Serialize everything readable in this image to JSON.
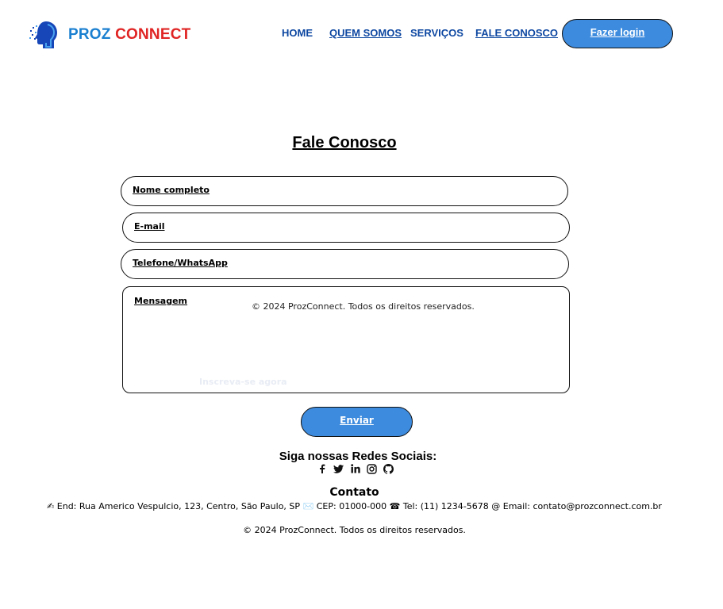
{
  "header": {
    "brand_part1": "PROZ",
    "brand_part2": "CONNECT",
    "nav": [
      {
        "label": "HOME"
      },
      {
        "label": "QUEM SOMOS"
      },
      {
        "label": "SERVIÇOS"
      },
      {
        "label": "FALE CONOSCO"
      }
    ],
    "login_label": "Fazer login"
  },
  "page": {
    "title": "Fale Conosco"
  },
  "form": {
    "name_label": "Nome completo",
    "email_label": "E-mail",
    "phone_label": "Telefone/WhatsApp",
    "message_label": "Mensagem",
    "overlay_copyright": "© 2024 ProzConnect. Todos os direitos reservados.",
    "ghost_link": "Inscreva-se agora",
    "submit_label": "Enviar"
  },
  "footer": {
    "social_title": "Siga nossas Redes Sociais:",
    "social_icons": [
      "facebook-icon",
      "twitter-icon",
      "linkedin-icon",
      "instagram-icon",
      "github-icon"
    ],
    "contact_title": "Contato",
    "address": "✍ End: Rua Americo Vespulcio, 123, Centro, São Paulo, SP",
    "cep": "✉️ CEP: 01000-000",
    "phone": "☎ Tel: (11) 1234-5678",
    "email": "@ Email: contato@prozconnect.com.br",
    "copyright": "© 2024 ProzConnect. Todos os direitos reservados."
  },
  "colors": {
    "brand_blue": "#1a7fd0",
    "brand_red": "#e02424",
    "nav_blue": "#0d47a1",
    "button_blue": "#3d8bde"
  }
}
